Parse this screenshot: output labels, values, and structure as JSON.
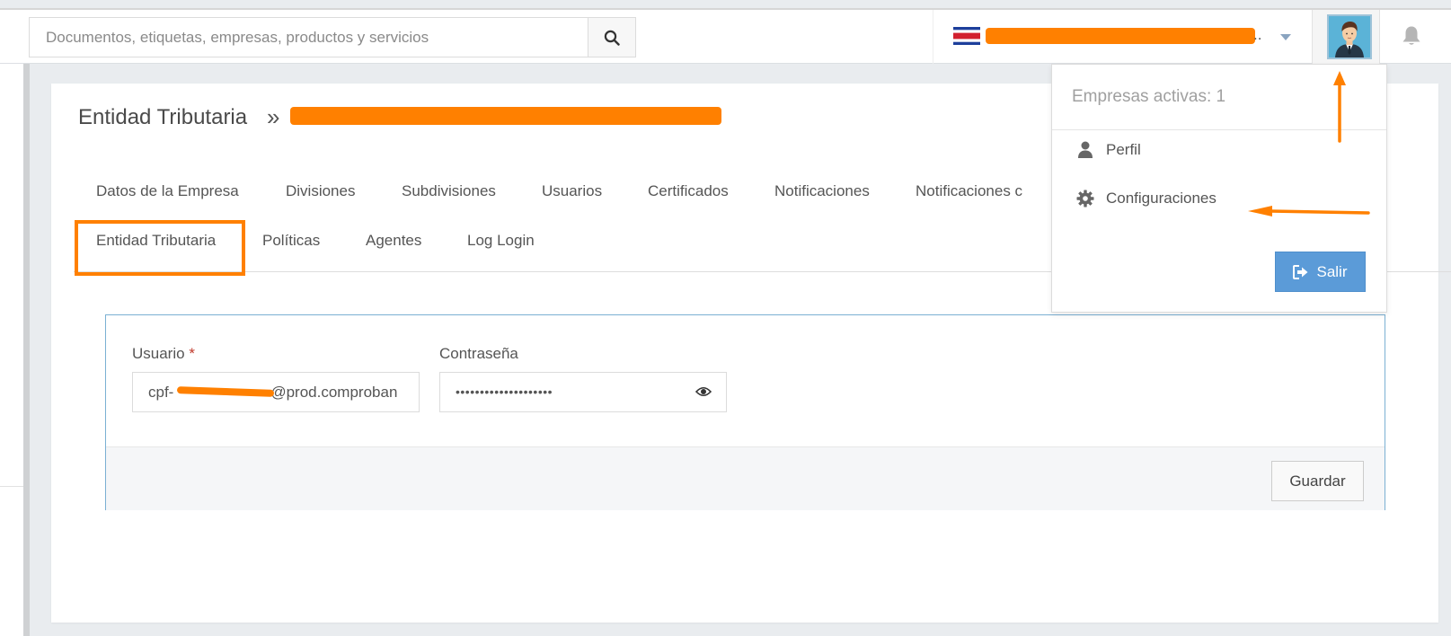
{
  "topbar": {
    "search": {
      "placeholder": "Documentos, etiquetas, empresas, productos y servicios",
      "value": ""
    },
    "company": {
      "ellipsis": "..",
      "flag": "costa-rica-flag"
    },
    "icons": {
      "search": "search-icon",
      "avatar": "avatar-icon",
      "bell": "bell-icon",
      "caret": "caret-down-icon"
    }
  },
  "page": {
    "title": "Entidad Tributaria",
    "separator": "»"
  },
  "tabs": [
    {
      "label": "Datos de la Empresa"
    },
    {
      "label": "Divisiones"
    },
    {
      "label": "Subdivisiones"
    },
    {
      "label": "Usuarios"
    },
    {
      "label": "Certificados"
    },
    {
      "label": "Notificaciones"
    },
    {
      "label": "Notificaciones c"
    },
    {
      "label": "Entidad Tributaria",
      "active": true
    },
    {
      "label": "Políticas"
    },
    {
      "label": "Agentes"
    },
    {
      "label": "Log Login"
    }
  ],
  "form": {
    "user_label": "Usuario",
    "required_mark": "*",
    "user_prefix": "cpf-",
    "user_suffix": "@prod.comproban",
    "password_label": "Contraseña",
    "password_value": "••••••••••••••••••••",
    "save_label": "Guardar"
  },
  "dropdown": {
    "title": "Empresas activas: 1",
    "items": [
      {
        "label": "Perfil",
        "icon": "user-icon"
      },
      {
        "label": "Configuraciones",
        "icon": "gear-icon"
      }
    ],
    "logout_label": "Salir"
  },
  "colors": {
    "accent": "#ff8000",
    "primary_button": "#5b9bd8",
    "panel_border": "#7bb0d3"
  }
}
